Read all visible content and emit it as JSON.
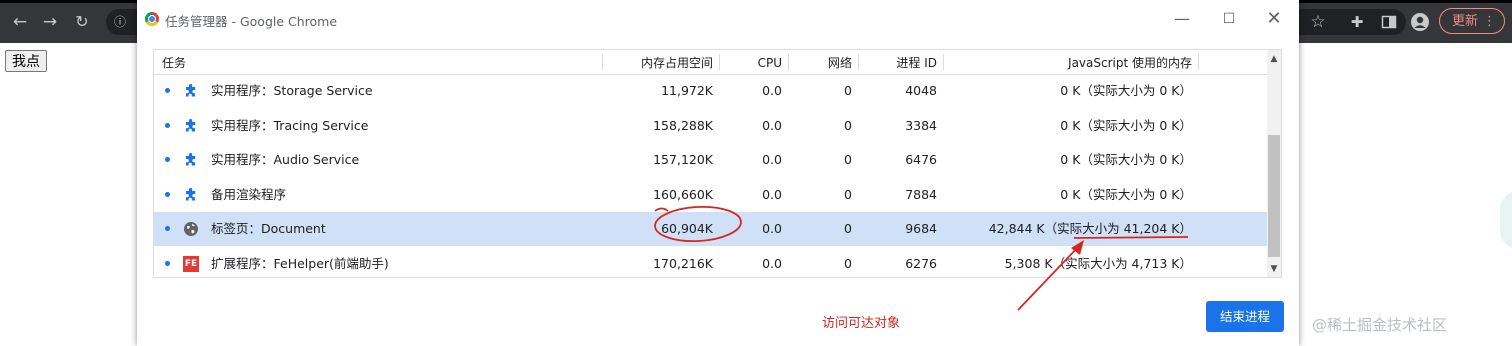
{
  "browser": {
    "update_label": "更新",
    "update_menu_icon": "⋮",
    "icons": [
      "back-icon",
      "forward-icon",
      "reload-icon",
      "info-icon",
      "bookmark-star-icon",
      "extensions-icon",
      "side-panel-icon",
      "profile-icon"
    ]
  },
  "page": {
    "button_label": "我点"
  },
  "window": {
    "title": "任务管理器 - Google Chrome",
    "controls": [
      "minimize-icon",
      "maximize-icon",
      "close-icon"
    ]
  },
  "table": {
    "headers": {
      "task": "任务",
      "memory": "内存占用空间",
      "cpu": "CPU",
      "network": "网络",
      "pid": "进程 ID",
      "js_memory": "JavaScript 使用的内存"
    },
    "rows": [
      {
        "icon": "puzzle-icon",
        "task": "实用程序：Storage Service",
        "memory": "11,972K",
        "cpu": "0.0",
        "network": "0",
        "pid": "4048",
        "js": "0 K（实际大小为 0 K）",
        "selected": false
      },
      {
        "icon": "puzzle-icon",
        "task": "实用程序：Tracing Service",
        "memory": "158,288K",
        "cpu": "0.0",
        "network": "0",
        "pid": "3384",
        "js": "0 K（实际大小为 0 K）",
        "selected": false
      },
      {
        "icon": "puzzle-icon",
        "task": "实用程序：Audio Service",
        "memory": "157,120K",
        "cpu": "0.0",
        "network": "0",
        "pid": "6476",
        "js": "0 K（实际大小为 0 K）",
        "selected": false
      },
      {
        "icon": "puzzle-icon",
        "task": "备用渲染程序",
        "memory": "160,660K",
        "cpu": "0.0",
        "network": "0",
        "pid": "7884",
        "js": "0 K（实际大小为 0 K）",
        "selected": false
      },
      {
        "icon": "globe-icon",
        "task": "标签页：Document",
        "memory": "60,904K",
        "cpu": "0.0",
        "network": "0",
        "pid": "9684",
        "js": "42,844 K（实际大小为 41,204 K）",
        "selected": true
      },
      {
        "icon": "fe-helper-icon",
        "icon_text": "FE",
        "task": "扩展程序：FeHelper(前端助手)",
        "memory": "170,216K",
        "cpu": "0.0",
        "network": "0",
        "pid": "6276",
        "js": "5,308 K（实际大小为 4,713 K）",
        "selected": false
      }
    ]
  },
  "end_button_label": "结束进程",
  "annotation": {
    "text": "访问可达对象",
    "color": "#d7261e"
  },
  "watermark": "@稀土掘金技术社区",
  "colors": {
    "accent": "#1a73e8",
    "selected_row": "#cfe0f7",
    "annotation": "#d7261e"
  }
}
